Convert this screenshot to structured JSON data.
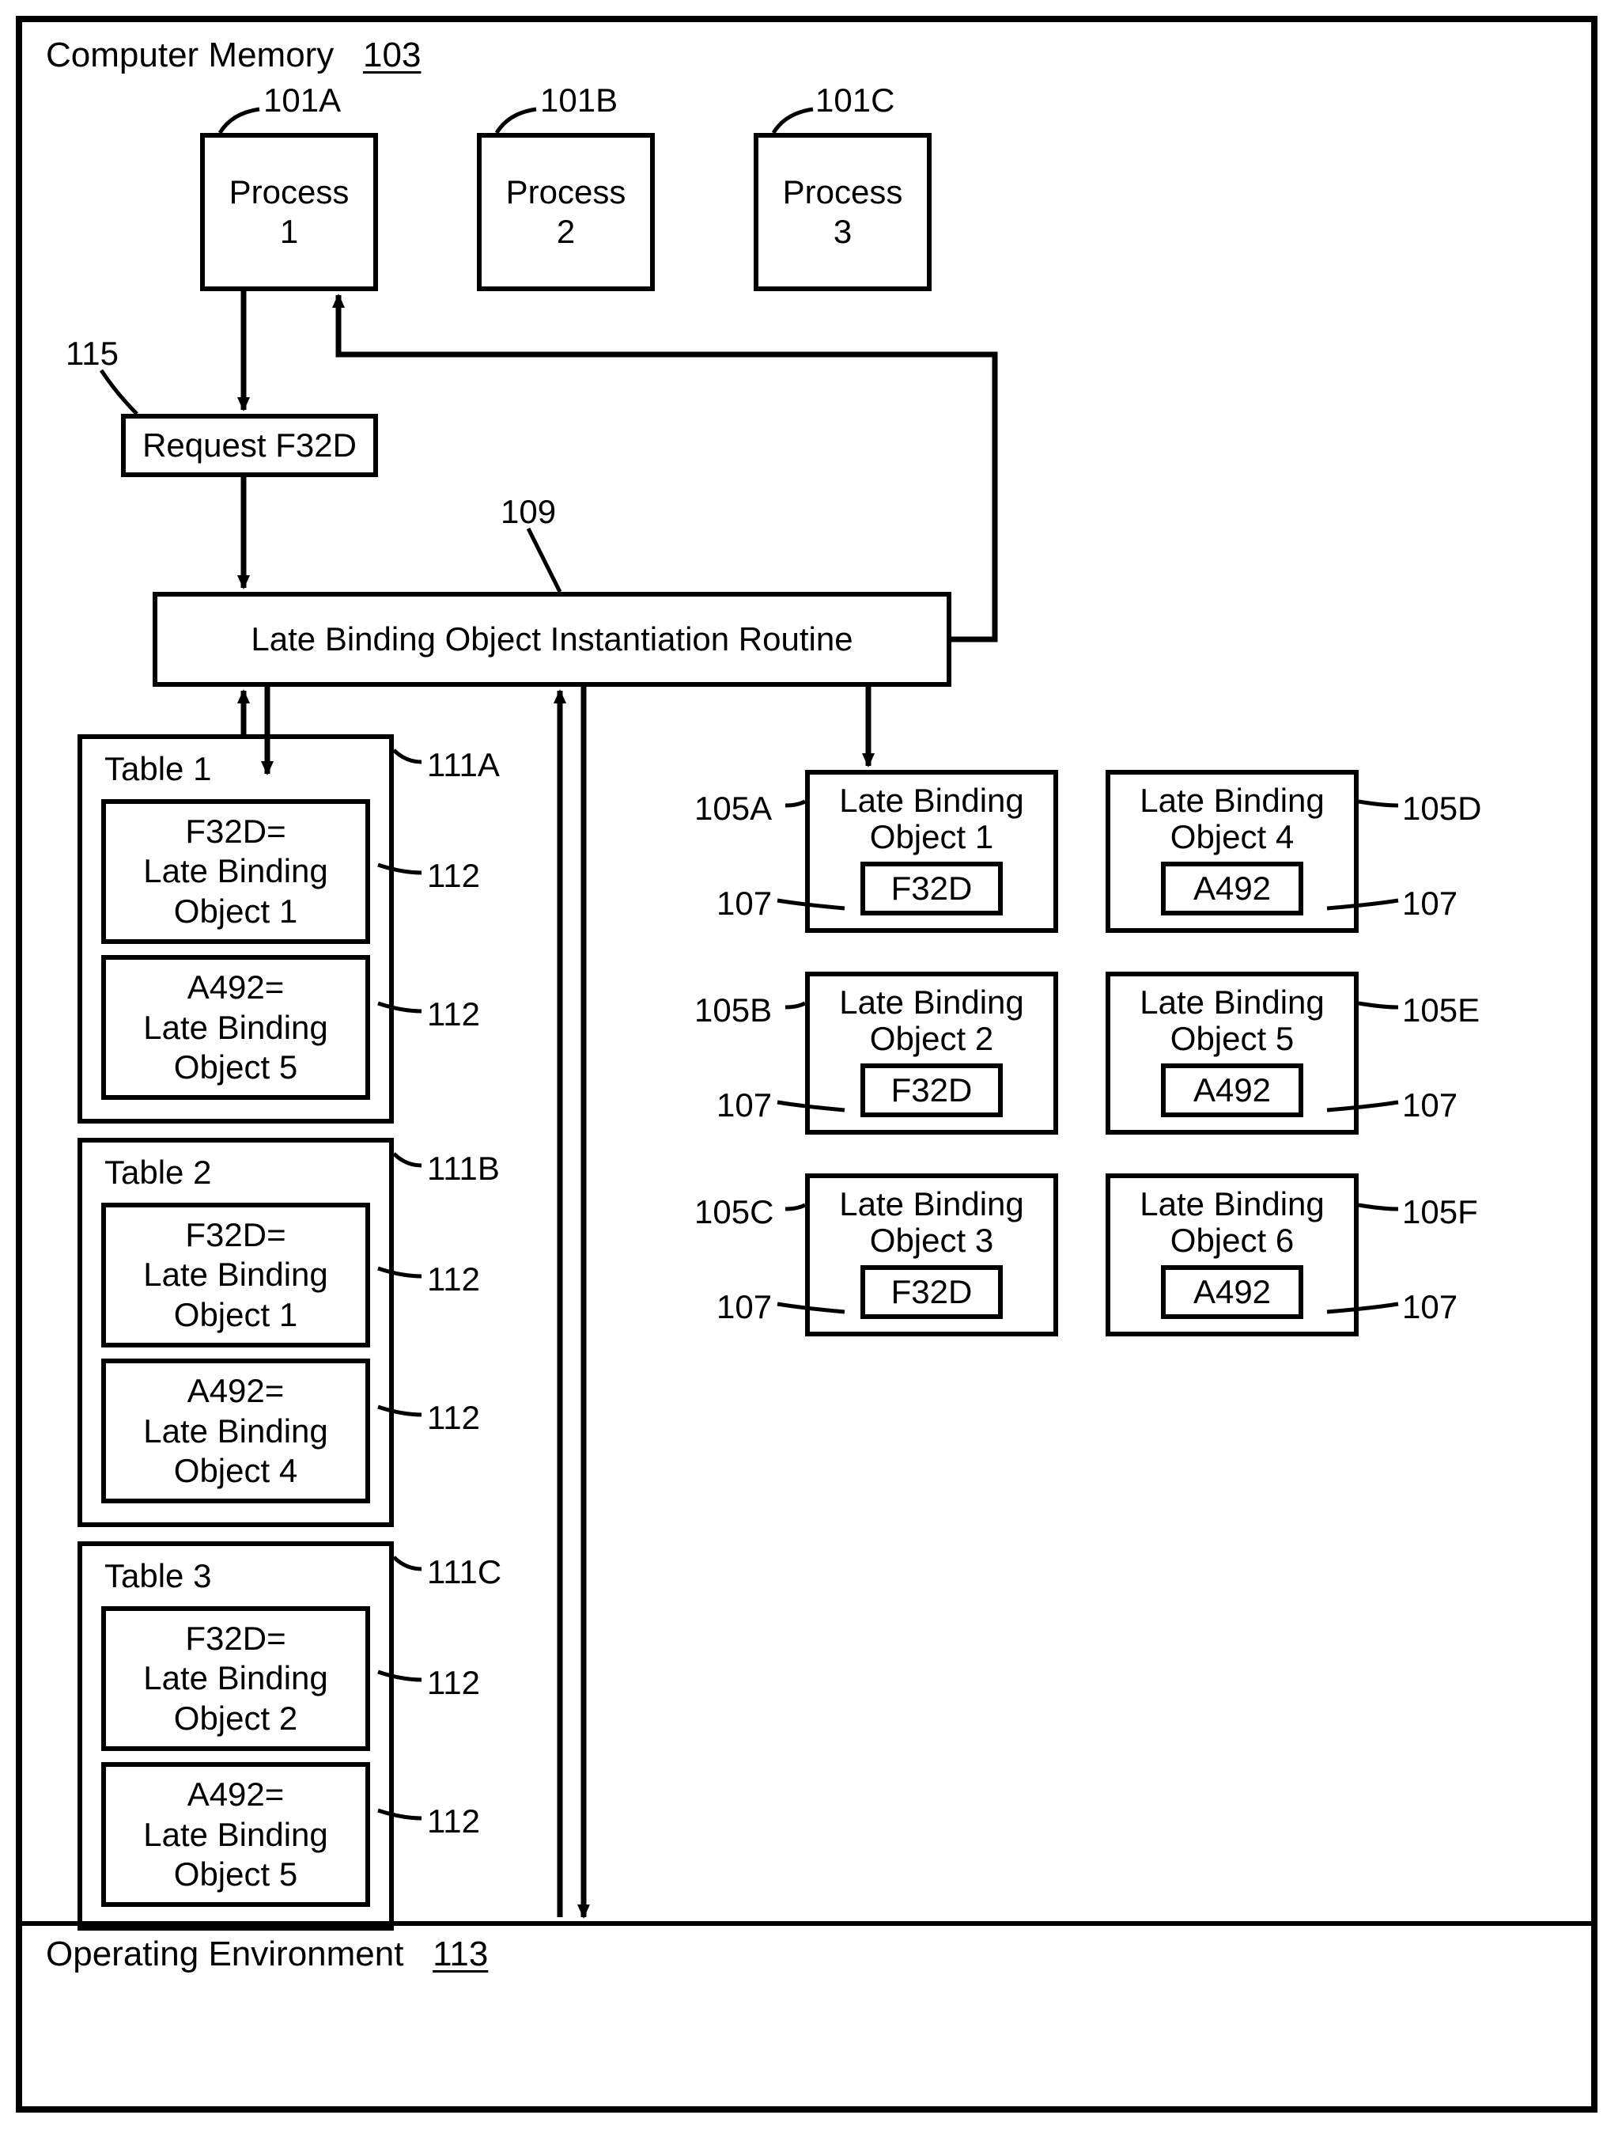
{
  "memory": {
    "title": "Computer Memory",
    "ref": "103"
  },
  "processes": [
    {
      "label": "Process\n1",
      "ref": "101A"
    },
    {
      "label": "Process\n2",
      "ref": "101B"
    },
    {
      "label": "Process\n3",
      "ref": "101C"
    }
  ],
  "request": {
    "label": "Request F32D",
    "ref": "115"
  },
  "routine": {
    "label": "Late Binding Object Instantiation Routine",
    "ref": "109"
  },
  "tables": [
    {
      "title": "Table 1",
      "ref": "111A",
      "entries": [
        {
          "text": "F32D=\nLate Binding\nObject 1",
          "ref": "112"
        },
        {
          "text": "A492=\nLate Binding\nObject 5",
          "ref": "112"
        }
      ]
    },
    {
      "title": "Table 2",
      "ref": "111B",
      "entries": [
        {
          "text": "F32D=\nLate Binding\nObject 1",
          "ref": "112"
        },
        {
          "text": "A492=\nLate Binding\nObject 4",
          "ref": "112"
        }
      ]
    },
    {
      "title": "Table 3",
      "ref": "111C",
      "entries": [
        {
          "text": "F32D=\nLate Binding\nObject 2",
          "ref": "112"
        },
        {
          "text": "A492=\nLate Binding\nObject 5",
          "ref": "112"
        }
      ]
    }
  ],
  "lbo": [
    {
      "title": "Late Binding\nObject 1",
      "id": "F32D",
      "ref": "105A",
      "idref": "107"
    },
    {
      "title": "Late Binding\nObject 2",
      "id": "F32D",
      "ref": "105B",
      "idref": "107"
    },
    {
      "title": "Late Binding\nObject 3",
      "id": "F32D",
      "ref": "105C",
      "idref": "107"
    },
    {
      "title": "Late Binding\nObject 4",
      "id": "A492",
      "ref": "105D",
      "idref": "107"
    },
    {
      "title": "Late Binding\nObject 5",
      "id": "A492",
      "ref": "105E",
      "idref": "107"
    },
    {
      "title": "Late Binding\nObject 6",
      "id": "A492",
      "ref": "105F",
      "idref": "107"
    }
  ],
  "env": {
    "title": "Operating Environment",
    "ref": "113"
  }
}
